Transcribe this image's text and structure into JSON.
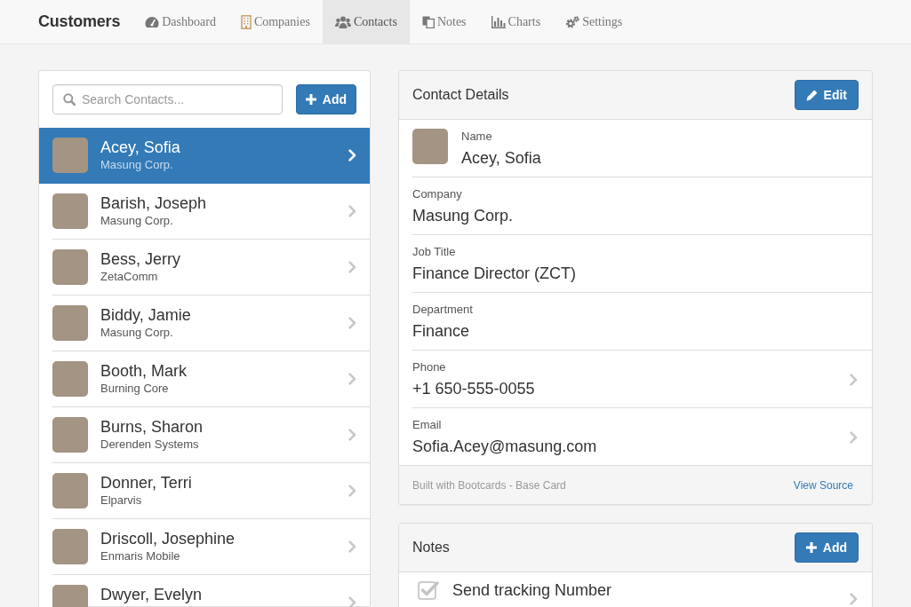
{
  "navbar": {
    "brand": "Customers",
    "items": [
      {
        "label": "Dashboard",
        "selected": false
      },
      {
        "label": "Companies",
        "selected": false
      },
      {
        "label": "Contacts",
        "selected": true
      },
      {
        "label": "Notes",
        "selected": false
      },
      {
        "label": "Charts",
        "selected": false
      },
      {
        "label": "Settings",
        "selected": false
      }
    ]
  },
  "contacts_panel": {
    "search": {
      "placeholder": "Search Contacts..."
    },
    "add_button": "Add",
    "contacts": [
      {
        "name": "Acey, Sofia",
        "company": "Masung Corp.",
        "selected": true
      },
      {
        "name": "Barish, Joseph",
        "company": "Masung Corp.",
        "selected": false
      },
      {
        "name": "Bess, Jerry",
        "company": "ZetaComm",
        "selected": false
      },
      {
        "name": "Biddy, Jamie",
        "company": "Masung Corp.",
        "selected": false
      },
      {
        "name": "Booth, Mark",
        "company": "Burning Core",
        "selected": false
      },
      {
        "name": "Burns, Sharon",
        "company": "Derenden Systems",
        "selected": false
      },
      {
        "name": "Donner, Terri",
        "company": "Elparvis",
        "selected": false
      },
      {
        "name": "Driscoll, Josephine",
        "company": "Enmaris Mobile",
        "selected": false
      },
      {
        "name": "Dwyer, Evelyn",
        "selected": false
      }
    ]
  },
  "contact_details": {
    "title": "Contact Details",
    "edit_button": "Edit",
    "fields": [
      {
        "kind": "photo",
        "label": "Name",
        "value": "Acey, Sofia"
      },
      {
        "kind": "text",
        "label": "Company",
        "value": "Masung Corp."
      },
      {
        "kind": "text",
        "label": "Job Title",
        "value": "Finance Director (ZCT)"
      },
      {
        "kind": "text",
        "label": "Department",
        "value": "Finance"
      },
      {
        "kind": "link",
        "label": "Phone",
        "value": "+1 650-555-0055"
      },
      {
        "kind": "link",
        "label": "Email",
        "value": "Sofia.Acey@masung.com"
      }
    ],
    "footer": {
      "text": "Built with Bootcards - Base Card",
      "link": "View Source"
    }
  },
  "notes": {
    "title": "Notes",
    "add_button": "Add",
    "items": [
      {
        "title": "Send tracking Number",
        "checked": true
      }
    ]
  }
}
